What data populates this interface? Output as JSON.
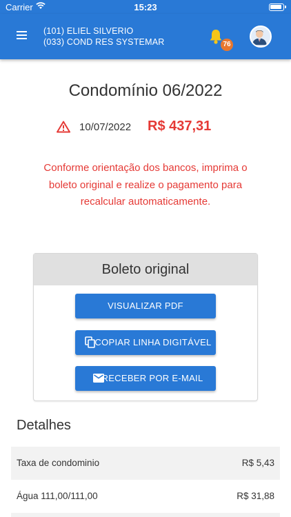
{
  "status_bar": {
    "carrier": "Carrier",
    "time": "15:23"
  },
  "header": {
    "line1": "(101) ELIEL SILVERIO",
    "line2": "(033) COND RES SYSTEMAR",
    "notification_count": "76"
  },
  "main": {
    "title": "Condomínio 06/2022",
    "due_date": "10/07/2022",
    "amount": "R$ 437,31",
    "notice": "Conforme orientação dos bancos, imprima o boleto original e realize o pagamento para recalcular automaticamente."
  },
  "boleto": {
    "title": "Boleto original",
    "view_pdf_label": "VISUALIZAR PDF",
    "copy_line_label": "COPIAR LINHA DIGITÁVEL",
    "email_label": "RECEBER POR E-MAIL"
  },
  "details": {
    "title": "Detalhes",
    "rows": [
      {
        "label": "Taxa de condominio",
        "value": "R$ 5,43"
      },
      {
        "label": "Água 111,00/111,00",
        "value": "R$ 31,88"
      }
    ]
  },
  "colors": {
    "primary": "#2979d6",
    "danger": "#e53935",
    "badge": "#e8772e",
    "bell": "#f5c518"
  },
  "icons": [
    "menu-icon",
    "bell-icon",
    "avatar",
    "warning-icon",
    "copy-icon",
    "mail-icon"
  ]
}
